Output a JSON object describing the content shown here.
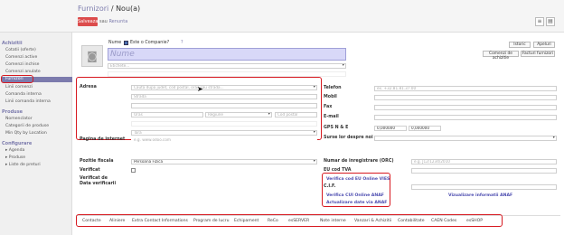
{
  "header": {
    "breadcrumb_parent": "Furnizori",
    "breadcrumb_sep": " / ",
    "breadcrumb_current": "Nou(a)",
    "save_label": "Salveaza",
    "discard_prefix": "sau",
    "discard_label": "Renunta"
  },
  "sidebar": {
    "sections": [
      {
        "title": "Achizitii",
        "items": [
          "Cotatii (oferte)",
          "Comenzi active",
          "Comenzi inchise",
          "Comenzi anulate",
          "Furnizori",
          "Linii comenzi",
          "Comanda interna",
          "Linii comanda interna"
        ]
      },
      {
        "title": "Produse",
        "items": [
          "Nomenclator",
          "Categorii de produse",
          "Min Qty by Location"
        ]
      },
      {
        "title": "Configurare",
        "items": [
          "Agenda",
          "Produse",
          "Liste de preturi"
        ]
      }
    ],
    "active_item": "Furnizori"
  },
  "form": {
    "name_label": "Nume",
    "company_label": "Este o Companie?",
    "help_mark": "?",
    "name_placeholder": "Nume",
    "category_placeholder": "Etichete...",
    "buttons": {
      "istoric": "Istoric",
      "apeluri": "Apeluri",
      "comenzi": "Comenzi de achizitie",
      "facturi": "Facturi furnizori"
    },
    "address_label": "Adresa",
    "address_placeholder": "Cauta dupa judet, cod postal, oras sau strada...",
    "street_placeholder": "Strada",
    "city_placeholder": "Oras",
    "state_placeholder": "Regiune",
    "zip_placeholder": "Cod postal",
    "country_placeholder": "Tara",
    "website_label": "Pagina de internet",
    "website_placeholder": "e.g. www.odoo.com",
    "phone_label": "Telefon",
    "phone_placeholder": "ex. +32.81.81.37.00",
    "mobile_label": "Mobil",
    "fax_label": "Fax",
    "email_label": "E-mail",
    "gps_label": "GPS N & E",
    "gps_n": "0,000000",
    "gps_e": "0,000000",
    "lang_label": "Surse lor despre noi",
    "fiscal_label": "Pozitie fiscala",
    "fiscal_value": "Persoana Fizica",
    "verified_label": "Verificat",
    "verified_date_label": "Verificat de\nData verificarii",
    "reg_label": "Numar de inregistrare (ORC)",
    "reg_placeholder": "e.g. J12/1234/2010",
    "vat_label": "EU cod TVA",
    "vies_link": "Verifica cod EU Online VIES",
    "cif_label": "C.I.F.",
    "anaf_link": "Verifica CUI Online ANAF",
    "anaf_update_link": "Actualizare date via ANAF",
    "anaf_view_link": "Vizualizare informatii ANAF"
  },
  "tabs": [
    "Contacte",
    "Aliniere",
    "Extra Contact Informations",
    "Program de lucru",
    "Echipament",
    "ReCo",
    "esSERVER",
    "Note interne",
    "Vanzari & Achizitii",
    "Contabilitate",
    "CAEN Codes",
    "esSHOP"
  ]
}
